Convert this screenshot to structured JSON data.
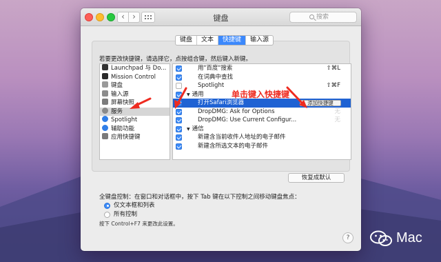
{
  "window": {
    "title": "键盘"
  },
  "search": {
    "placeholder": "搜索"
  },
  "tabs": [
    {
      "label": "键盘",
      "active": false
    },
    {
      "label": "文本",
      "active": false
    },
    {
      "label": "快捷键",
      "active": true
    },
    {
      "label": "输入源",
      "active": false
    }
  ],
  "instruction": "若要更改快捷键，请选择它，点按组合键，然后键入新键。",
  "categories": [
    {
      "label": "Launchpad 与 Do...",
      "icon": "launchpad-icon",
      "color": "#333333"
    },
    {
      "label": "Mission Control",
      "icon": "mission-control-icon",
      "color": "#2a2a2a"
    },
    {
      "label": "键盘",
      "icon": "keyboard-icon",
      "color": "#9a9a9a"
    },
    {
      "label": "输入源",
      "icon": "input-source-icon",
      "color": "#8c8c8c"
    },
    {
      "label": "屏幕快照",
      "icon": "screenshot-icon",
      "color": "#7c7c7c"
    },
    {
      "label": "服务",
      "icon": "services-gear-icon",
      "color": "#8a8a8a",
      "selected": true
    },
    {
      "label": "Spotlight",
      "icon": "spotlight-icon",
      "color": "#2f7ee8"
    },
    {
      "label": "辅助功能",
      "icon": "accessibility-icon",
      "color": "#2f7ee8"
    },
    {
      "label": "应用快捷键",
      "icon": "app-shortcuts-icon",
      "color": "#7a7a7a"
    }
  ],
  "shortcuts": [
    {
      "type": "item",
      "label": "用\"百度\"搜索",
      "checked": true,
      "shortcut": "⇧⌘L"
    },
    {
      "type": "item",
      "label": "在词典中查找",
      "checked": true,
      "shortcut": ""
    },
    {
      "type": "item",
      "label": "Spotlight",
      "checked": false,
      "shortcut": "⇧⌘F"
    },
    {
      "type": "group",
      "label": "通用",
      "checked": true
    },
    {
      "type": "item",
      "label": "打开Safari浏览器",
      "checked": true,
      "selected": true,
      "button": "添加快捷键"
    },
    {
      "type": "item",
      "label": "DropDMG: Ask for Options",
      "checked": true,
      "shortcut": "无",
      "faint": true
    },
    {
      "type": "item",
      "label": "DropDMG: Use Current Configur...",
      "checked": true,
      "shortcut": "无",
      "faint": true
    },
    {
      "type": "group",
      "label": "通信",
      "checked": true
    },
    {
      "type": "item",
      "label": "新建含当前收件人地址的电子邮件",
      "checked": true,
      "shortcut": ""
    },
    {
      "type": "item",
      "label": "新建含所选文本的电子邮件",
      "checked": true,
      "shortcut": ""
    }
  ],
  "restore_button": "恢复成默认",
  "full_keyboard": {
    "title": "全键盘控制：在窗口和对话框中，按下 Tab 键在以下控制之间移动键盘焦点：",
    "options": [
      {
        "label": "仅文本框和列表",
        "selected": true
      },
      {
        "label": "所有控制",
        "selected": false
      }
    ],
    "hint": "按下 Control+F7 来更改此设置。"
  },
  "help": "?",
  "annotation": "单击键入快捷键",
  "watermark": "Mac",
  "colors": {
    "accent": "#3b88fc",
    "selection": "#1f62d3",
    "annotation": "#ee2b20"
  }
}
